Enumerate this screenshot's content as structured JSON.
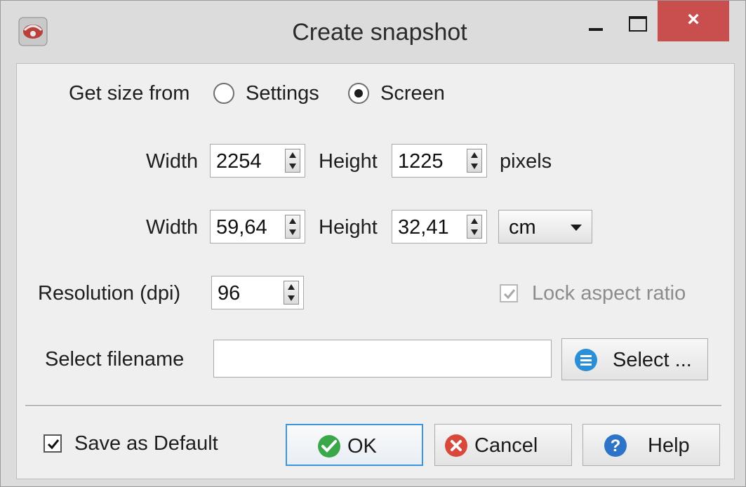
{
  "window": {
    "title": "Create snapshot",
    "close_glyph": "×"
  },
  "size_source": {
    "label": "Get size from",
    "options": [
      "Settings",
      "Screen"
    ],
    "selected": "Screen"
  },
  "pixels_row": {
    "width_label": "Width",
    "width_value": "2254",
    "height_label": "Height",
    "height_value": "1225",
    "unit": "pixels"
  },
  "units_row": {
    "width_label": "Width",
    "width_value": "59,64",
    "height_label": "Height",
    "height_value": "32,41",
    "unit_selected": "cm"
  },
  "resolution": {
    "label": "Resolution (dpi)",
    "value": "96"
  },
  "lock_aspect": {
    "label": "Lock aspect ratio",
    "checked": true,
    "enabled": false
  },
  "filename": {
    "label": "Select filename",
    "value": "",
    "button_label": "Select ..."
  },
  "save_default": {
    "label": "Save as Default",
    "checked": true
  },
  "buttons": {
    "ok": "OK",
    "cancel": "Cancel",
    "help": "Help"
  },
  "colors": {
    "close_red": "#c94f4f",
    "focus_blue": "#3c95dd",
    "ok_green": "#3aa84a",
    "cancel_red": "#d9493b",
    "help_blue": "#2f73c9",
    "select_blue": "#2a8fd6"
  },
  "icons": [
    "app-icon",
    "minimize-icon",
    "maximize-icon",
    "close-icon",
    "list-icon",
    "ok-check-icon",
    "cancel-x-icon",
    "help-question-icon",
    "checkmark-icon"
  ]
}
